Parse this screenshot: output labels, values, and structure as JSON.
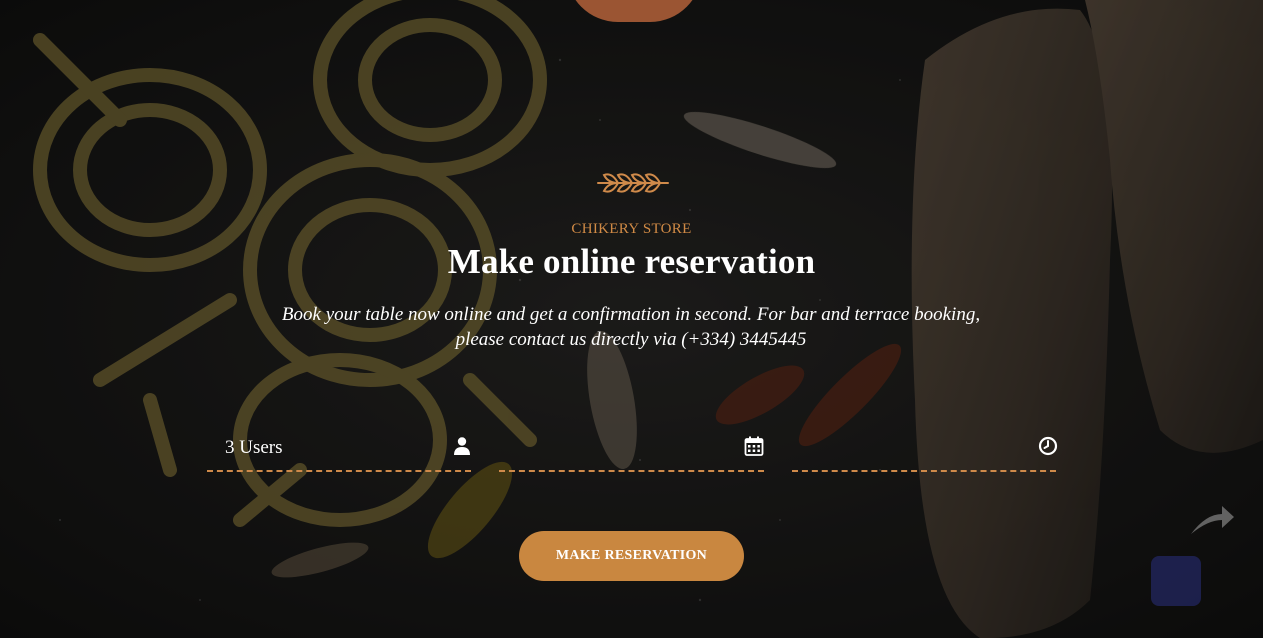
{
  "hero": {
    "eyebrow": "CHIKERY STORE",
    "title": "Make online reservation",
    "subtitle": "Book your table now online and get a confirmation in second. For bar and terrace booking, please contact us directly via (+334) 3445445"
  },
  "form": {
    "guests": {
      "value": "3 Users",
      "icon": "user-icon"
    },
    "date": {
      "value": "",
      "icon": "calendar-icon"
    },
    "time": {
      "value": "",
      "icon": "clock-icon"
    },
    "submit_label": "MAKE RESERVATION"
  },
  "colors": {
    "accent": "#c98740",
    "eyebrow": "#d08a45",
    "background": "#1c1b1a"
  }
}
